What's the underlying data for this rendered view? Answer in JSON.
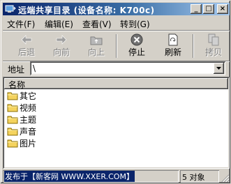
{
  "window": {
    "title": "远端共享目录 (设备名称: K700c)",
    "controls": {
      "minimize": "_",
      "maximize": "□",
      "close": "×"
    }
  },
  "menu": {
    "items": [
      {
        "label": "文件(F)"
      },
      {
        "label": "编辑(E)"
      },
      {
        "label": "查看(V)"
      },
      {
        "label": "转到(G)"
      }
    ]
  },
  "toolbar": {
    "buttons": [
      {
        "label": "后退",
        "icon": "back-arrow-icon",
        "enabled": false
      },
      {
        "label": "向前",
        "icon": "forward-arrow-icon",
        "enabled": false
      },
      {
        "label": "向上",
        "icon": "up-folder-icon",
        "enabled": false
      },
      {
        "label": "停止",
        "icon": "stop-icon",
        "enabled": true
      },
      {
        "label": "刷新",
        "icon": "refresh-icon",
        "enabled": true
      },
      {
        "label": "拷贝",
        "icon": "copy-icon",
        "enabled": false
      }
    ]
  },
  "address": {
    "label": "地址",
    "value": "\\"
  },
  "list": {
    "column_header": "名称",
    "items": [
      {
        "name": "其它",
        "icon": "folder-icon"
      },
      {
        "name": "视频",
        "icon": "folder-icon"
      },
      {
        "name": "主题",
        "icon": "folder-icon"
      },
      {
        "name": "声音",
        "icon": "folder-icon"
      },
      {
        "name": "图片",
        "icon": "folder-icon"
      }
    ]
  },
  "status": {
    "left": "发布于【新客网 WWW.XXER.COM】",
    "right": "5 对象"
  },
  "colors": {
    "title_bar_start": "#0a246a",
    "title_bar_end": "#a6caf0",
    "window_face": "#d4d0c8",
    "folder_yellow": "#f4d35e"
  }
}
